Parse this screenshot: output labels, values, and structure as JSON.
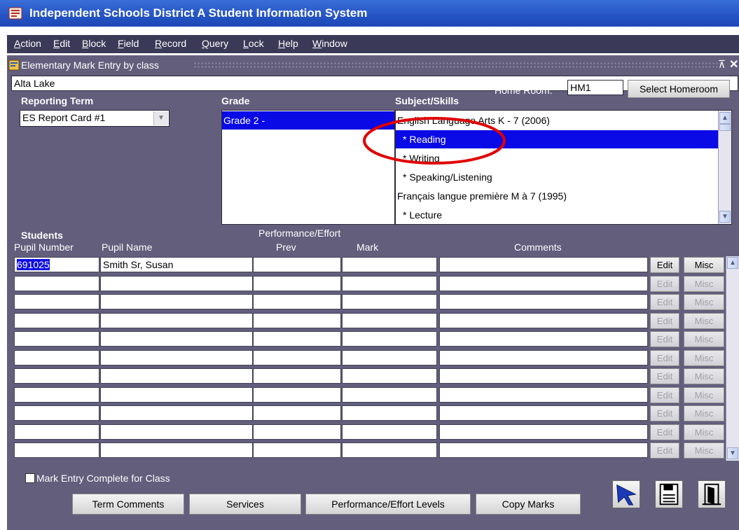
{
  "app": {
    "title": "Independent Schools District A Student Information System"
  },
  "menu": [
    "Action",
    "Edit",
    "Block",
    "Field",
    "Record",
    "Query",
    "Lock",
    "Help",
    "Window"
  ],
  "window": {
    "title": "Elementary Mark Entry by class",
    "minimize_glyph": "⊼",
    "close_glyph": "✕"
  },
  "school": "Alta Lake",
  "homeroom": {
    "label": "Home Room:",
    "value": "HM1",
    "button": "Select Homeroom"
  },
  "reporting_term": {
    "label": "Reporting Term",
    "value": "ES Report Card #1"
  },
  "grade": {
    "label": "Grade",
    "items": [
      "Grade 2 -"
    ]
  },
  "subjects": {
    "label": "Subject/Skills",
    "items": [
      {
        "text": "English Language Arts K - 7 (2006)",
        "selected": false
      },
      {
        "text": "* Reading",
        "selected": true
      },
      {
        "text": "* Writing",
        "selected": false
      },
      {
        "text": "* Speaking/Listening",
        "selected": false
      },
      {
        "text": "Français langue première M à 7 (1995)",
        "selected": false
      },
      {
        "text": "* Lecture",
        "selected": false
      }
    ]
  },
  "students": {
    "section_label": "Students",
    "group_label": "Performance/Effort",
    "columns": [
      "Pupil Number",
      "Pupil Name",
      "Prev",
      "Mark",
      "Comments"
    ],
    "rows": [
      {
        "pupil_number": "691025",
        "pupil_name": "Smith Sr, Susan",
        "prev": "",
        "mark": "",
        "comments": "",
        "enabled": true
      },
      {
        "pupil_number": "",
        "pupil_name": "",
        "prev": "",
        "mark": "",
        "comments": "",
        "enabled": false
      },
      {
        "pupil_number": "",
        "pupil_name": "",
        "prev": "",
        "mark": "",
        "comments": "",
        "enabled": false
      },
      {
        "pupil_number": "",
        "pupil_name": "",
        "prev": "",
        "mark": "",
        "comments": "",
        "enabled": false
      },
      {
        "pupil_number": "",
        "pupil_name": "",
        "prev": "",
        "mark": "",
        "comments": "",
        "enabled": false
      },
      {
        "pupil_number": "",
        "pupil_name": "",
        "prev": "",
        "mark": "",
        "comments": "",
        "enabled": false
      },
      {
        "pupil_number": "",
        "pupil_name": "",
        "prev": "",
        "mark": "",
        "comments": "",
        "enabled": false
      },
      {
        "pupil_number": "",
        "pupil_name": "",
        "prev": "",
        "mark": "",
        "comments": "",
        "enabled": false
      },
      {
        "pupil_number": "",
        "pupil_name": "",
        "prev": "",
        "mark": "",
        "comments": "",
        "enabled": false
      },
      {
        "pupil_number": "",
        "pupil_name": "",
        "prev": "",
        "mark": "",
        "comments": "",
        "enabled": false
      },
      {
        "pupil_number": "",
        "pupil_name": "",
        "prev": "",
        "mark": "",
        "comments": "",
        "enabled": false
      }
    ],
    "edit_label": "Edit",
    "misc_label": "Misc"
  },
  "complete_checkbox": {
    "label": "Mark Entry Complete for Class",
    "checked": false
  },
  "buttons": {
    "term_comments": "Term Comments",
    "services": "Services",
    "performance_levels": "Performance/Effort Levels",
    "copy_marks": "Copy Marks"
  },
  "icons": {
    "app": "school-crest-icon",
    "navigate": "arrow-pointer-icon",
    "save": "floppy-save-icon",
    "exit": "exit-door-icon"
  },
  "annotation": {
    "color": "#e00000",
    "target": "* Reading"
  },
  "colors": {
    "title_bar": "#2553c4",
    "window_bg": "#625e7c",
    "selection": "#0a0ae6",
    "menubar": "#3a3a58"
  }
}
